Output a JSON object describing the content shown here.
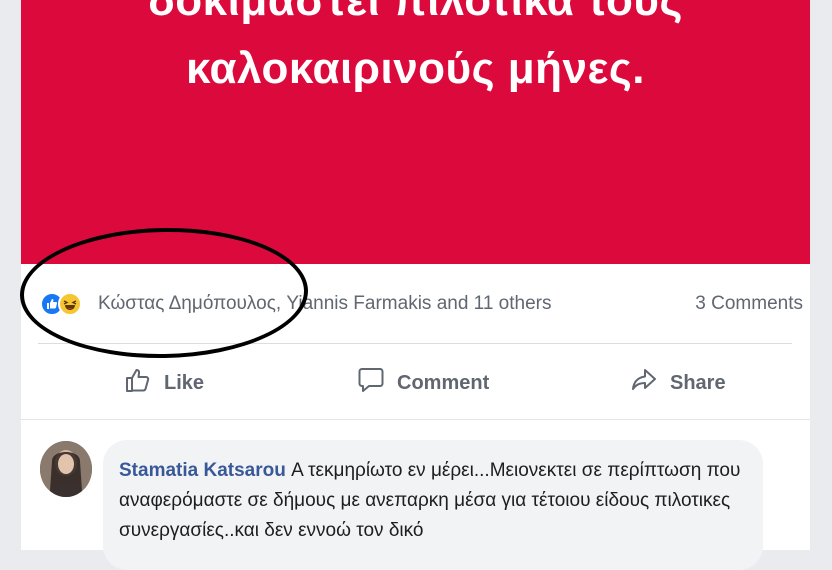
{
  "post": {
    "banner_lines": [
      "δοκιμάστει πιλοτικά τους",
      "καλοκαιρινούς μήνες."
    ],
    "banner_color": "#dc0a3c",
    "reactions": {
      "icons": [
        "like-icon",
        "haha-icon"
      ],
      "names_text": "Κώστας Δημόπουλος, Yiannis Farmakis and 11 others",
      "comments_count": "3 Comments"
    },
    "actions": {
      "like_label": "Like",
      "comment_label": "Comment",
      "share_label": "Share"
    }
  },
  "comment": {
    "author": "Stamatia Katsarou",
    "text": "Α τεκμηρίωτο εν μέρει...Μειονεκτει σε περίπτωση που αναφερόμαστε σε δήμους με ανεπαρκη μέσα για τέτοιου είδους πιλοτικες συνεργασίες..και δεν εννοώ τον δικό"
  },
  "annotation": {
    "shape": "ellipse",
    "color": "#000000"
  }
}
